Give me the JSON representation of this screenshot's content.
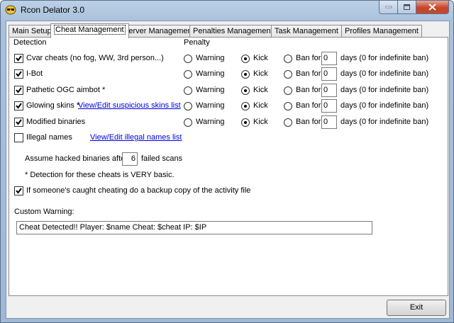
{
  "window": {
    "title": "Rcon Delator 3.0"
  },
  "tabs": [
    {
      "label": "Main Setup"
    },
    {
      "label": "Cheat Management",
      "active": true
    },
    {
      "label": "Server Management"
    },
    {
      "label": "Penalties Management"
    },
    {
      "label": "Task Management"
    },
    {
      "label": "Profiles Management"
    }
  ],
  "detection": {
    "header": "Detection",
    "penalty_header": "Penalty",
    "rows": [
      {
        "label": "Cvar cheats (no fog, WW, 3rd person...)",
        "checked": true,
        "penalty": "kick",
        "ban_days": "0"
      },
      {
        "label": "I-Bot",
        "checked": true,
        "penalty": "kick",
        "ban_days": "0"
      },
      {
        "label": "Pathetic OGC aimbot *",
        "checked": true,
        "penalty": "kick",
        "ban_days": "0"
      },
      {
        "label": "Glowing skins *",
        "checked": true,
        "penalty": "kick",
        "ban_days": "0",
        "link": "View/Edit suspicious skins list"
      },
      {
        "label": "Modified binaries",
        "checked": true,
        "penalty": "kick",
        "ban_days": "0"
      }
    ],
    "warning_label": "Warning",
    "kick_label": "Kick",
    "ban_label": "Ban for",
    "days_label": "days (0 for indefinite ban)"
  },
  "illegal_names": {
    "label": "Illegal names",
    "checked": false,
    "link": "View/Edit illegal names list"
  },
  "hacked_binaries": {
    "prefix": "Assume hacked binaries after",
    "value": "6",
    "suffix": "failed scans"
  },
  "note": "* Detection for these cheats is VERY basic.",
  "backup": {
    "label": "If someone's caught cheating do a backup copy of the activity file",
    "checked": true
  },
  "custom_warning": {
    "label": "Custom Warning:",
    "value": "Cheat Detected!! Player: $name Cheat: $cheat IP: $IP"
  },
  "buttons": {
    "exit": "Exit"
  }
}
